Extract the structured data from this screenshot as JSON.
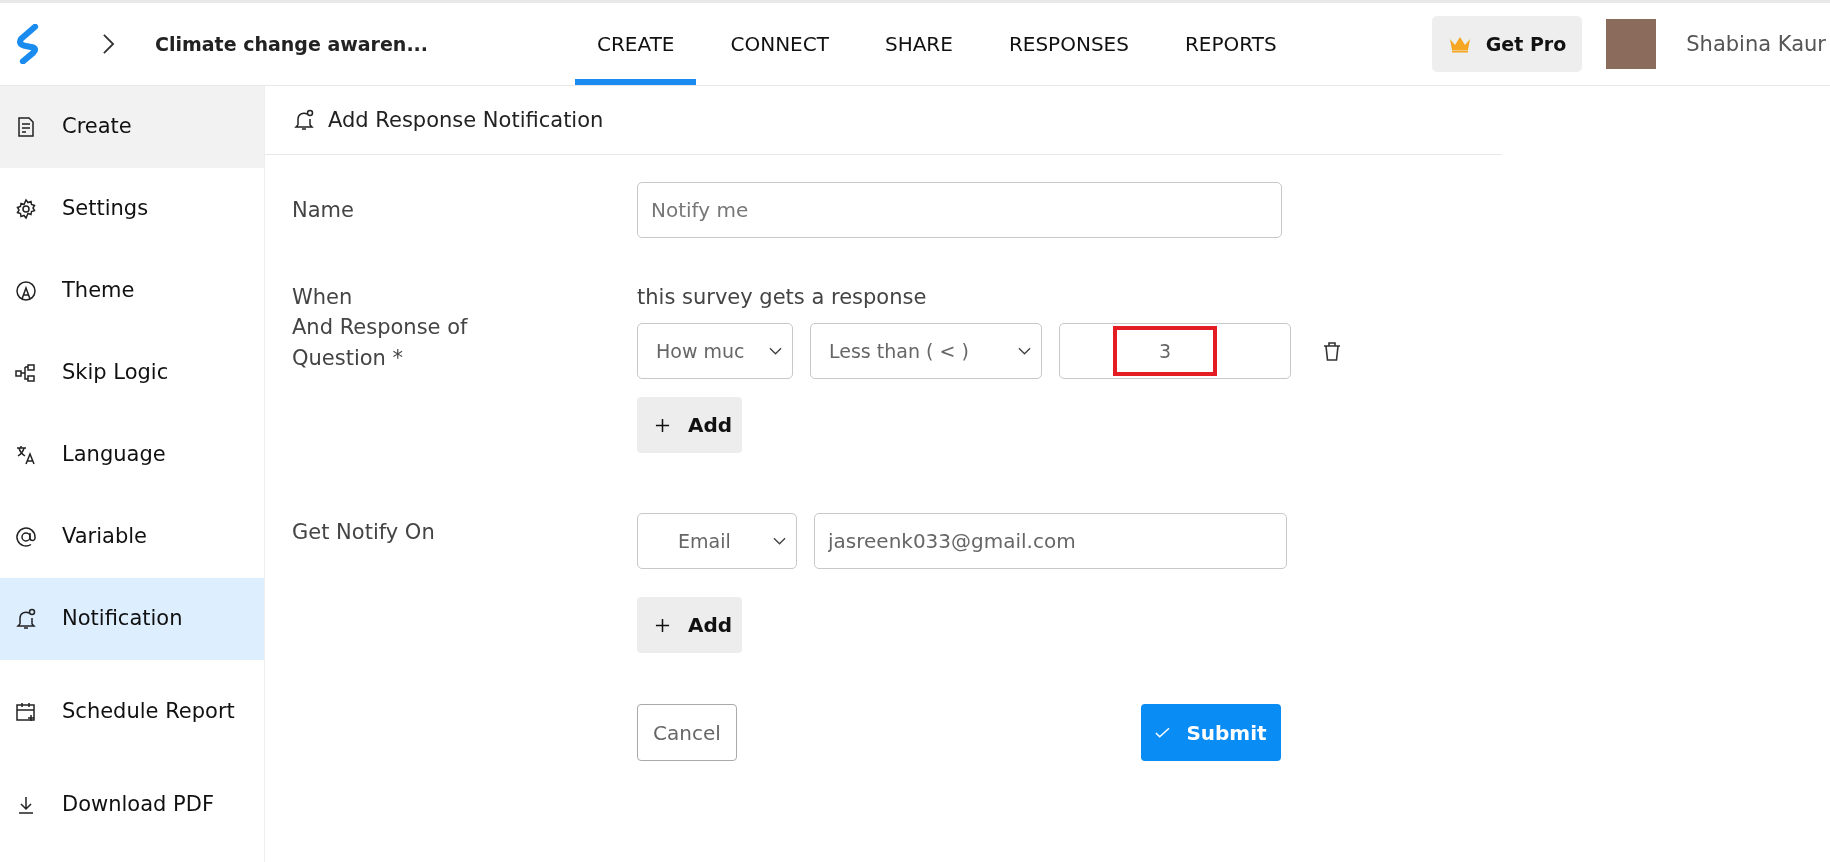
{
  "header": {
    "survey_title": "Climate change awaren...",
    "get_pro": "Get Pro",
    "user_name": "Shabina Kaur"
  },
  "tabs": [
    {
      "label": "CREATE",
      "selected": true
    },
    {
      "label": "CONNECT",
      "selected": false
    },
    {
      "label": "SHARE",
      "selected": false
    },
    {
      "label": "RESPONSES",
      "selected": false
    },
    {
      "label": "REPORTS",
      "selected": false
    }
  ],
  "sidebar": {
    "items": [
      {
        "label": "Create",
        "kind": "create",
        "selected": false,
        "hovered": true
      },
      {
        "label": "Settings",
        "kind": "settings",
        "selected": false,
        "hovered": false
      },
      {
        "label": "Theme",
        "kind": "theme",
        "selected": false,
        "hovered": false
      },
      {
        "label": "Skip Logic",
        "kind": "skip",
        "selected": false,
        "hovered": false
      },
      {
        "label": "Language",
        "kind": "language",
        "selected": false,
        "hovered": false
      },
      {
        "label": "Variable",
        "kind": "variable",
        "selected": false,
        "hovered": false
      },
      {
        "label": "Notification",
        "kind": "notification",
        "selected": true,
        "hovered": false
      },
      {
        "label": "Schedule Report",
        "kind": "schedule",
        "selected": false,
        "hovered": false
      },
      {
        "label": "Download PDF",
        "kind": "download",
        "selected": false,
        "hovered": false
      }
    ]
  },
  "panel": {
    "title": "Add Response Notification",
    "name_label": "Name",
    "name_placeholder": "Notify me",
    "when_label": "When",
    "condition_label": "And Response of Question *",
    "trigger_text": "this survey gets a response",
    "condition": {
      "question": "How muc",
      "operator": "Less than ( < )",
      "value": "3",
      "highlighted": true
    },
    "add_condition": "Add",
    "notify_label": "Get Notify On",
    "channel": "Email",
    "email": "jasreenk033@gmail.com",
    "add_channel": "Add",
    "cancel": "Cancel",
    "submit": "Submit"
  }
}
